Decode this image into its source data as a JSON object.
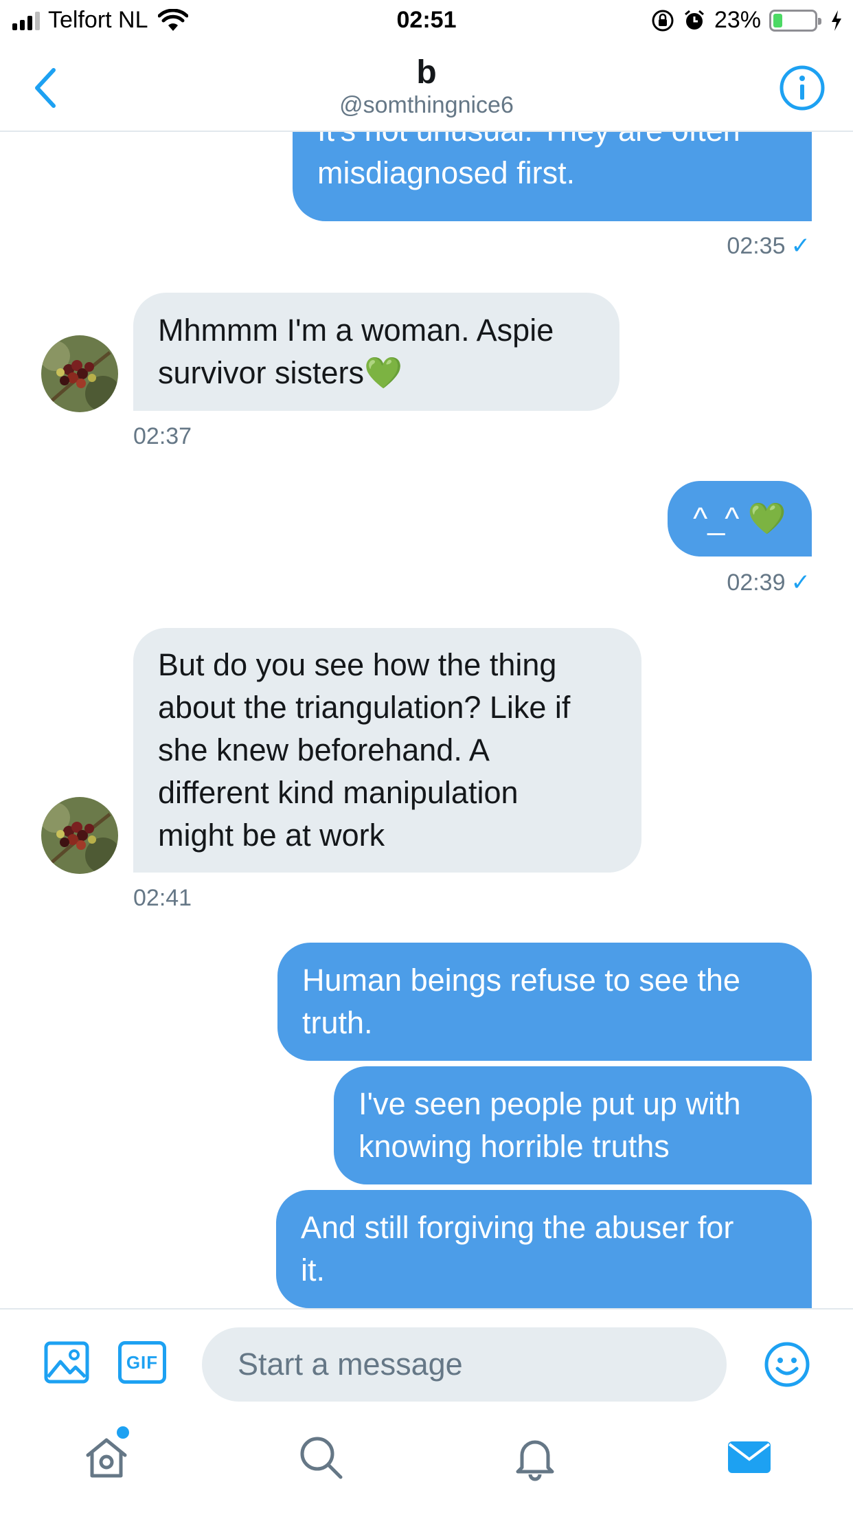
{
  "status_bar": {
    "carrier": "Telfort NL",
    "time": "02:51",
    "battery_percent": "23%",
    "battery_level": 0.23,
    "icons": [
      "signal-icon",
      "wifi-icon",
      "orientation-lock-icon",
      "alarm-icon",
      "battery-icon",
      "charging-icon"
    ]
  },
  "header": {
    "name": "b",
    "handle": "@somthingnice6",
    "back_icon": "chevron-left-icon",
    "info_icon": "info-icon"
  },
  "conversation": {
    "messages": [
      {
        "direction": "outgoing",
        "text": "It's not unusual. They are often\nmisdiagnosed first."
      },
      {
        "time": "02:35",
        "check": "✓"
      },
      {
        "direction": "incoming",
        "text": "Mhmmm I'm a woman. Aspie\nsurvivor sisters💚"
      },
      {
        "time": "02:37"
      },
      {
        "direction": "outgoing",
        "text": "^_^ 💚"
      },
      {
        "time": "02:39",
        "check": "✓"
      },
      {
        "direction": "incoming",
        "text": "But do you see how the thing\nabout the triangulation? Like if\nshe knew beforehand. A\ndifferent kind manipulation\nmight be at work"
      },
      {
        "time": "02:41"
      },
      {
        "direction": "outgoing",
        "text": "Human beings refuse to see the\ntruth."
      },
      {
        "direction": "outgoing",
        "text": "I've seen people put up with\nknowing horrible truths"
      },
      {
        "direction": "outgoing",
        "text": "And still forgiving the abuser for\nit."
      }
    ]
  },
  "composer": {
    "placeholder": "Start a message",
    "gif_label": "GIF",
    "icons": [
      "image-icon",
      "gif-icon",
      "emoji-icon"
    ]
  },
  "tab_bar": {
    "tabs": [
      "home-icon",
      "search-icon",
      "notifications-icon",
      "messages-icon"
    ],
    "active": "messages-icon"
  },
  "colors": {
    "accent": "#1da1f2",
    "outgoing_bubble": "#4c9de8",
    "incoming_bubble": "#e6ecf0",
    "secondary_text": "#657786"
  }
}
